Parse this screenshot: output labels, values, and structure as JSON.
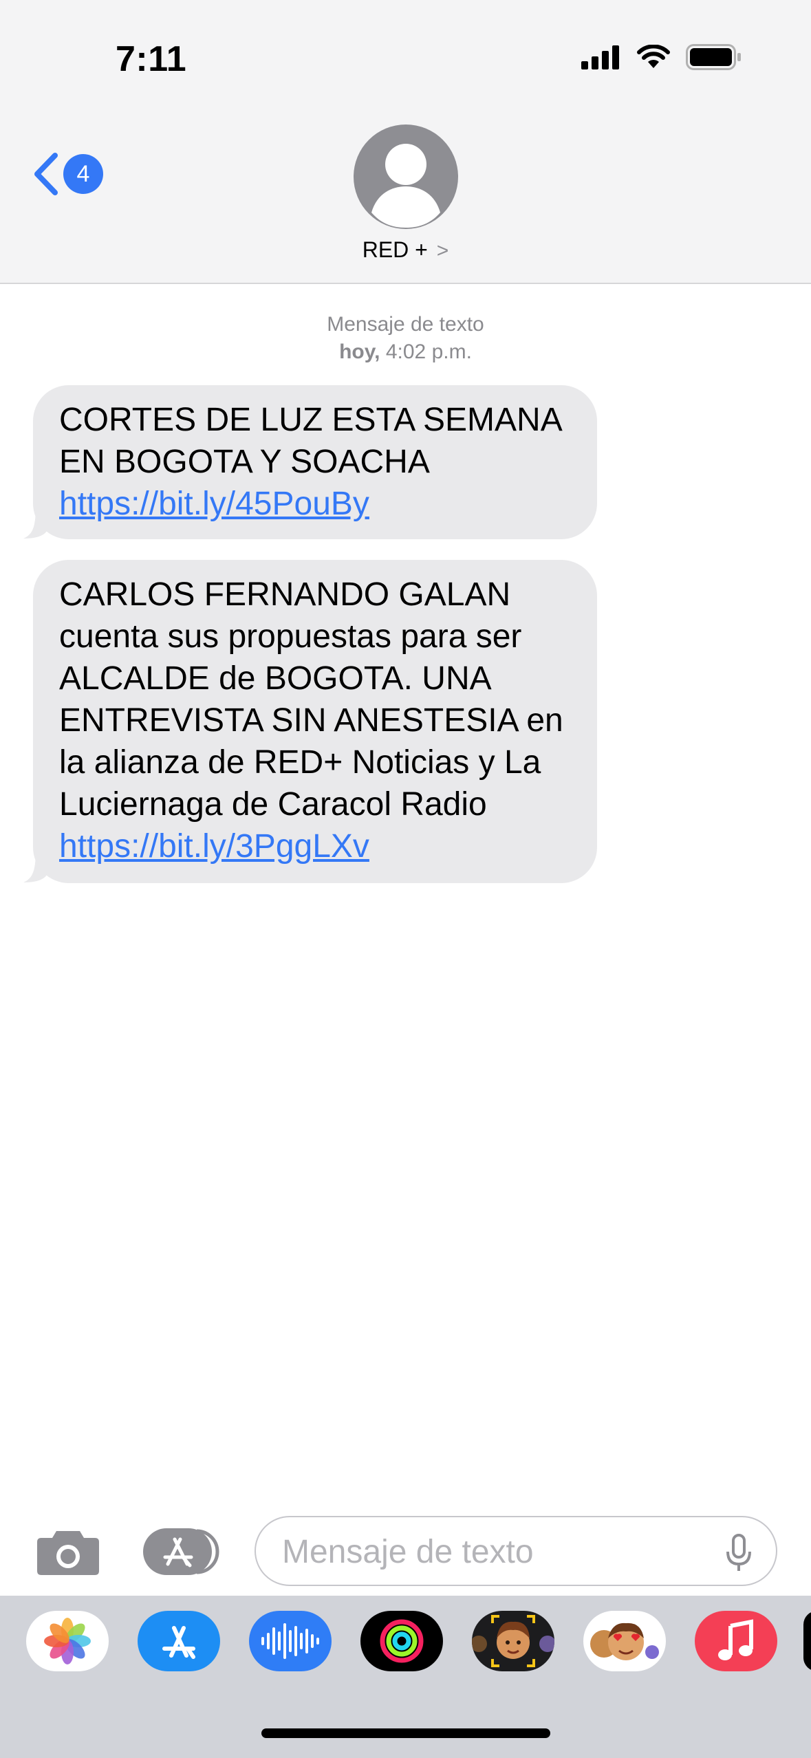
{
  "status_bar": {
    "time": "7:11"
  },
  "header": {
    "back_count": "4",
    "contact_name": "RED +",
    "contact_chevron": ">"
  },
  "conversation": {
    "timestamp_label": "Mensaje de texto",
    "timestamp_day": "hoy,",
    "timestamp_time": " 4:02 p.m.",
    "messages": [
      {
        "text": "CORTES DE LUZ ESTA SEMANA EN BOGOTA Y SOACHA ",
        "link": "https://bit.ly/45PouBy"
      },
      {
        "text": "CARLOS FERNANDO GALAN cuenta sus propuestas para ser ALCALDE de BOGOTA. UNA ENTREVISTA SIN ANESTESIA en la alianza de RED+ Noticias y La Luciernaga de Caracol Radio ",
        "link": "https://bit.ly/3PggLXv"
      }
    ]
  },
  "input": {
    "placeholder": "Mensaje de texto",
    "value": ""
  },
  "app_drawer": {
    "apps": [
      "photos-icon",
      "app-store-icon",
      "audio-message-icon",
      "activity-icon",
      "memoji-icon",
      "memoji-stickers-icon",
      "music-icon"
    ]
  },
  "colors": {
    "accent": "#3478f6",
    "bubble": "#e9e9eb",
    "header_bg": "#f4f4f5",
    "drawer_bg": "#d1d3d9"
  }
}
